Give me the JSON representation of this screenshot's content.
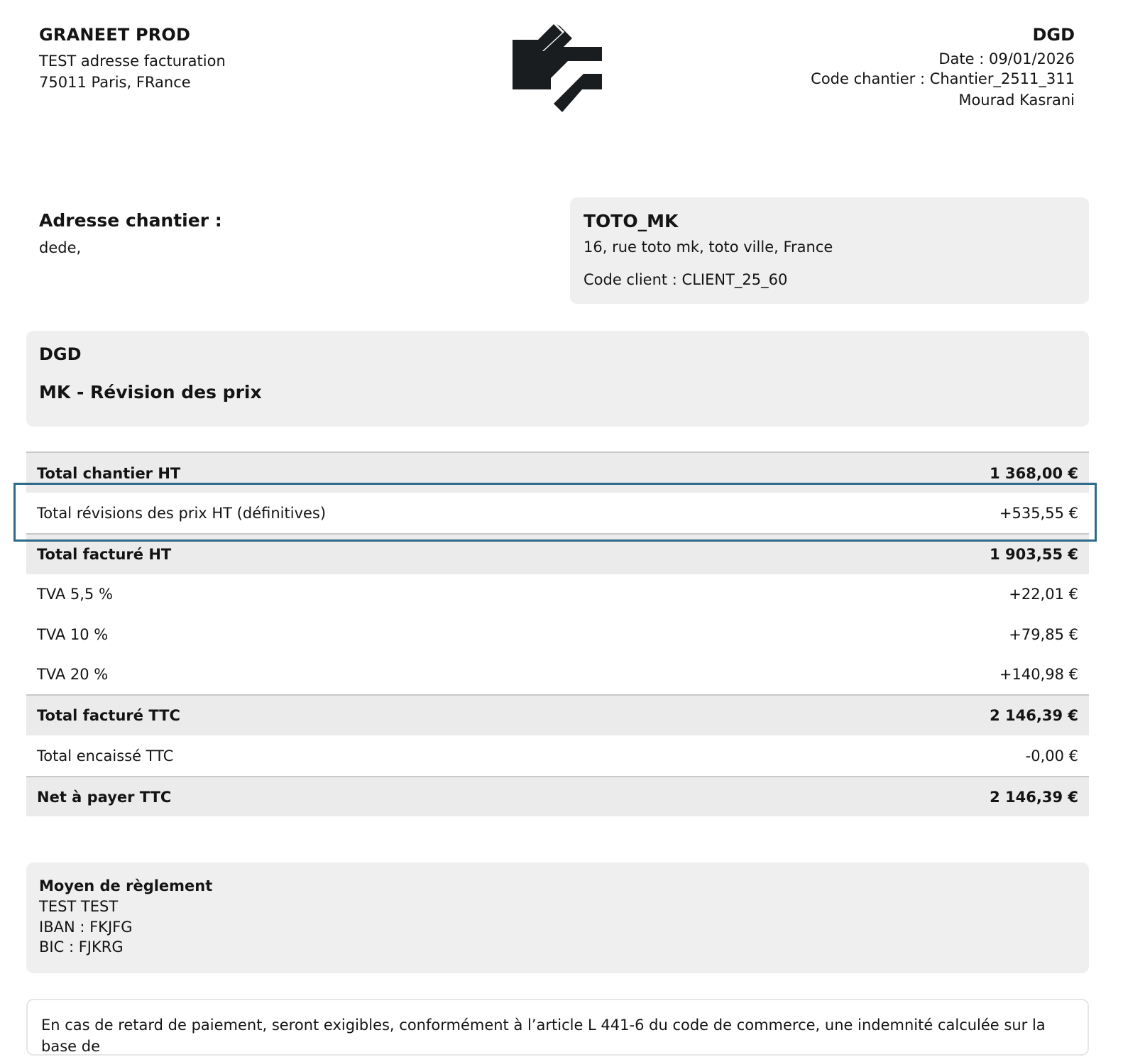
{
  "company": {
    "name": "GRANEET PROD",
    "address_line1": "TEST adresse facturation",
    "address_line2": "75011 Paris, FRance"
  },
  "document": {
    "type": "DGD",
    "date": "Date : 09/01/2026",
    "site_code": "Code chantier : Chantier_2511_311",
    "author": "Mourad Kasrani"
  },
  "logo": {
    "icon": "graneet-logo-icon",
    "color": "#1a1d1f"
  },
  "site": {
    "title": "Adresse chantier :",
    "address": "dede,"
  },
  "client": {
    "name": "TOTO_MK",
    "address": "16, rue toto mk, toto ville, France",
    "code": "Code client : CLIENT_25_60"
  },
  "title_box": {
    "type": "DGD",
    "name": "MK - Révision des prix"
  },
  "totals": [
    {
      "label": "Total chantier HT",
      "amount": "1 368,00 €",
      "strong": true
    },
    {
      "label": "Total révisions des prix HT (définitives)",
      "amount": "+535,55 €",
      "strong": false
    },
    {
      "label": "Total facturé HT",
      "amount": "1 903,55 €",
      "strong": true
    },
    {
      "label": "TVA 5,5 %",
      "amount": "+22,01 €",
      "strong": false
    },
    {
      "label": "TVA 10 %",
      "amount": "+79,85 €",
      "strong": false
    },
    {
      "label": "TVA 20 %",
      "amount": "+140,98 €",
      "strong": false
    },
    {
      "label": "Total facturé TTC",
      "amount": "2 146,39 €",
      "strong": true
    },
    {
      "label": "Total encaissé TTC",
      "amount": "-0,00 €",
      "strong": false
    },
    {
      "label": "Net à payer TTC",
      "amount": "2 146,39 €",
      "strong": true
    }
  ],
  "payment": {
    "title": "Moyen de règlement",
    "holder": "TEST TEST",
    "iban": "IBAN : FKJFG",
    "bic": "BIC : FJKRG"
  },
  "legal": {
    "text": "En cas de retard de paiement, seront exigibles, conformément à l’article L 441-6 du code de commerce, une indemnité calculée sur la base de"
  },
  "colors": {
    "highlight_border": "#2d6a8b",
    "panel_background": "#efefef",
    "strong_row_background": "#ebebeb"
  }
}
